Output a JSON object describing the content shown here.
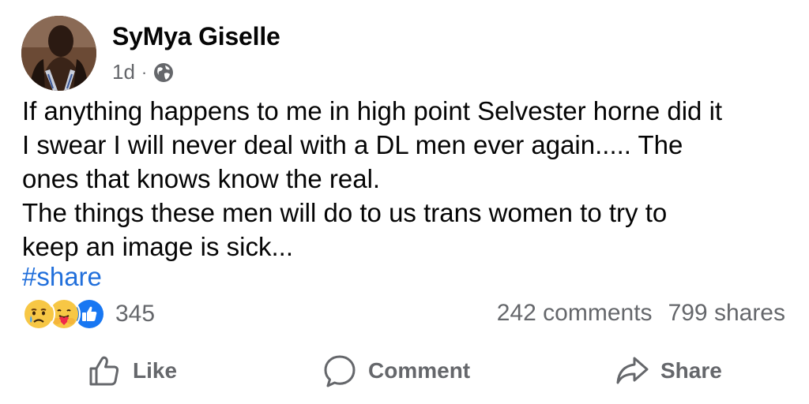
{
  "post": {
    "author": "SyMya Giselle",
    "time": "1d",
    "separator": "·",
    "audience_icon": "globe-icon",
    "text_lines": [
      "If anything happens to me in high point Selvester horne did it",
      "I swear I will never deal with a DL men ever again..... The",
      "ones that knows know the real.",
      "The things these men will do to us trans women to try to",
      "keep an image is sick..."
    ],
    "hashtag": "#share"
  },
  "engagement": {
    "reaction_icons": [
      "sad-cry-icon",
      "care-hug-icon",
      "like-thumb-icon"
    ],
    "reaction_count": "345",
    "comments": "242 comments",
    "shares": "799 shares"
  },
  "actions": {
    "like_label": "Like",
    "comment_label": "Comment",
    "share_label": "Share"
  },
  "colors": {
    "link": "#216fdb",
    "secondary_text": "#65676b",
    "like_blue": "#1877f2",
    "reaction_yellow": "#f7c745"
  }
}
